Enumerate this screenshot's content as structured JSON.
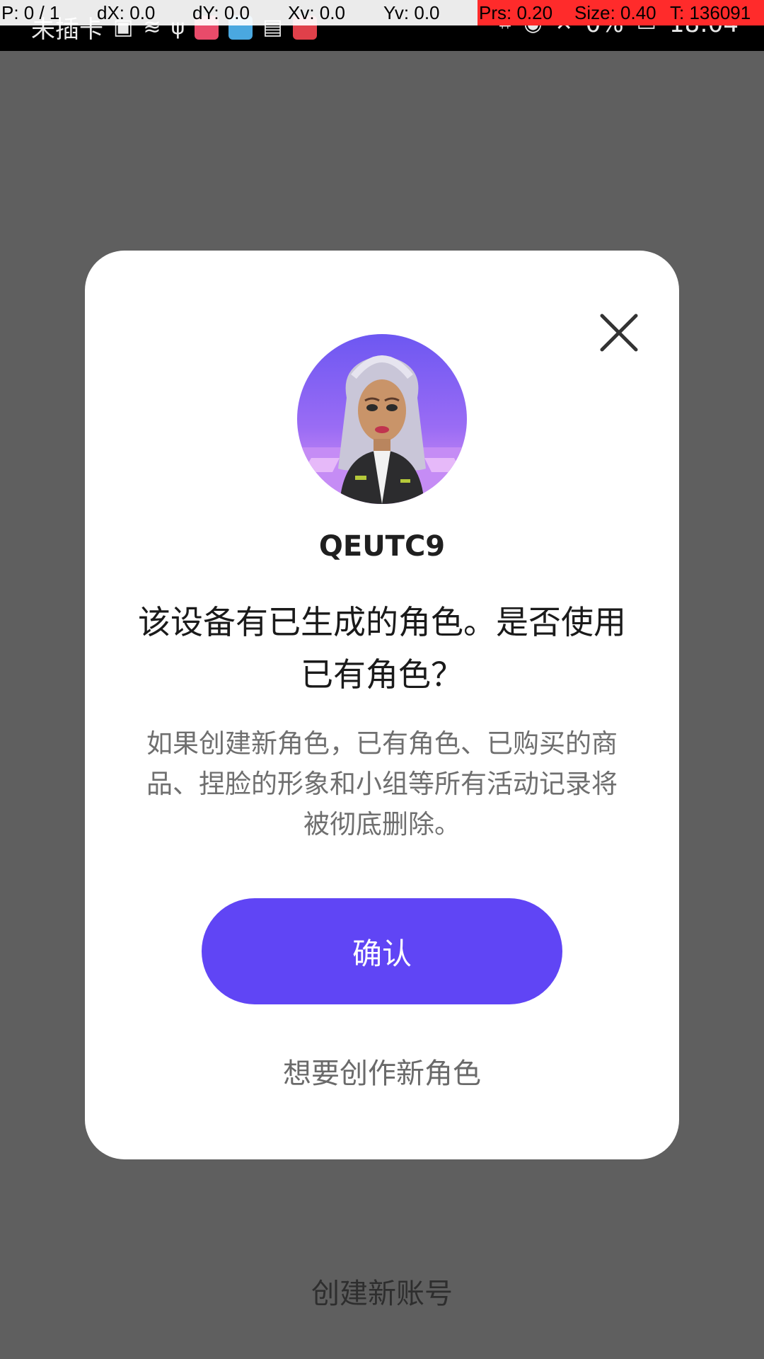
{
  "debug_overlay": {
    "p": "P: 0 / 1",
    "dx": "dX: 0.0",
    "dy": "dY: 0.0",
    "xv": "Xv: 0.0",
    "yv": "Yv: 0.0",
    "prs": "Prs: 0.20",
    "size": "Size: 0.40",
    "t": "T: 136091"
  },
  "status_bar": {
    "carrier": "未插卡",
    "battery": "0%",
    "time": "18:04"
  },
  "dialog": {
    "username": "QEUTC9",
    "title": "该设备有已生成的角色。是否使用已有角色？",
    "description": "如果创建新角色，已有角色、已购买的商品、捏脸的形象和小组等所有活动记录将被彻底删除。",
    "confirm_label": "确认",
    "create_new_role_label": "想要创作新角色"
  },
  "background": {
    "create_account_label": "创建新账号"
  },
  "colors": {
    "overlay": "#5f5f5f",
    "primary": "#6045f5",
    "card": "#ffffff"
  }
}
